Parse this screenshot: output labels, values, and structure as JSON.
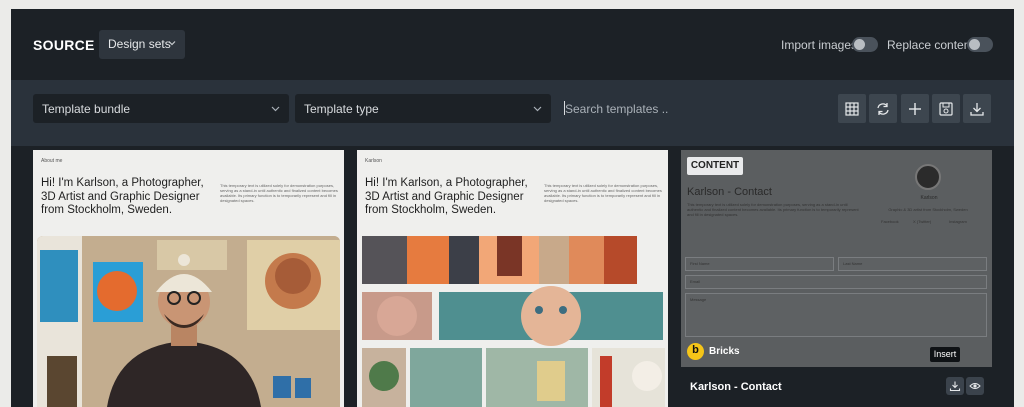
{
  "header": {
    "title": "SOURCE",
    "source_select": "Design sets",
    "import_images_label": "Import images",
    "replace_content_label": "Replace content"
  },
  "filters": {
    "bundle_placeholder": "Template bundle",
    "type_placeholder": "Template type",
    "search_placeholder": "Search templates ..",
    "actions": [
      "grid-icon",
      "refresh-icon",
      "plus-icon",
      "save-icon",
      "download-icon"
    ]
  },
  "cards": [
    {
      "kicker": "About me",
      "headline": "Hi! I'm Karlson, a Photographer, 3D Artist and Graphic Designer from Stockholm, Sweden.",
      "blurb": "This temporary text is utilized solely for demonstration purposes, serving as a stand-in until authentic and finalized content becomes available. Its primary function is to temporarily represent and fill in designated spaces."
    },
    {
      "kicker": "Karlson",
      "headline": "Hi! I'm Karlson, a Photographer, 3D Artist and Graphic Designer from Stockholm, Sweden.",
      "blurb": "This temporary text is utilized solely for demonstration purposes, serving as a stand-in until authentic and finalized content becomes available. Its primary function is to temporarily represent and fill in designated spaces."
    },
    {
      "badge": "CONTENT",
      "preview_title": "Karlson - Contact",
      "preview_blurb": "This temporary text is utilized solely for demonstration purposes, serving as a stand-in until authentic and finalized content becomes available. Its primary function is to temporarily represent and fill in designated spaces.",
      "avatar_name": "Karlson",
      "avatar_role": "Graphic & 3D artist from Stockholm, Sweden",
      "socials": [
        "Facebook",
        "X (Twitter)",
        "Instagram"
      ],
      "fields": {
        "first_name": "First Name",
        "last_name": "Last Name",
        "email": "Email",
        "message": "Message"
      },
      "provider": "Bricks",
      "name": "Karlson - Contact",
      "insert_tooltip": "Insert"
    }
  ],
  "colors": {
    "modal_bg": "#1c2126",
    "filter_bg": "#2a323b",
    "icon_btn": "#3d464f",
    "bricks_yellow": "#f5c518"
  }
}
